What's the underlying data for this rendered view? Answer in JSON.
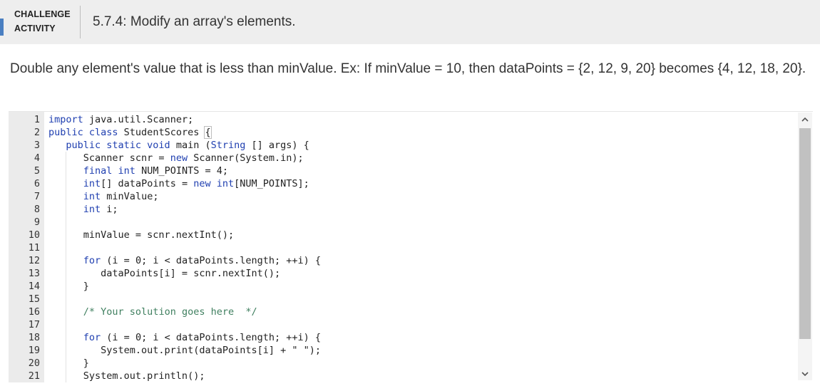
{
  "header": {
    "badge_line1": "CHALLENGE",
    "badge_line2": "ACTIVITY",
    "title": "5.7.4: Modify an array's elements."
  },
  "description": "Double any element's value that is less than minValue. Ex: If minValue = 10, then dataPoints = {2, 12, 9, 20} becomes {4, 12, 18, 20}.",
  "editor": {
    "lines": [
      {
        "n": "1",
        "parts": [
          {
            "t": "import",
            "c": "kw"
          },
          {
            "t": " java.util.Scanner;"
          }
        ]
      },
      {
        "n": "2",
        "parts": [
          {
            "t": "public class",
            "c": "kw"
          },
          {
            "t": " StudentScores "
          },
          {
            "t": "{",
            "c": "brace"
          }
        ]
      },
      {
        "n": "3",
        "parts": [
          {
            "t": "   "
          },
          {
            "t": "public static void",
            "c": "kw"
          },
          {
            "t": " main ("
          },
          {
            "t": "String",
            "c": "kw"
          },
          {
            "t": " [] args) {"
          }
        ]
      },
      {
        "n": "4",
        "parts": [
          {
            "t": "      Scanner scnr = "
          },
          {
            "t": "new",
            "c": "kw"
          },
          {
            "t": " Scanner(System.in);"
          }
        ]
      },
      {
        "n": "5",
        "parts": [
          {
            "t": "      "
          },
          {
            "t": "final int",
            "c": "kw"
          },
          {
            "t": " NUM_POINTS = 4;"
          }
        ]
      },
      {
        "n": "6",
        "parts": [
          {
            "t": "      "
          },
          {
            "t": "int",
            "c": "kw"
          },
          {
            "t": "[] dataPoints = "
          },
          {
            "t": "new int",
            "c": "kw"
          },
          {
            "t": "[NUM_POINTS];"
          }
        ]
      },
      {
        "n": "7",
        "parts": [
          {
            "t": "      "
          },
          {
            "t": "int",
            "c": "kw"
          },
          {
            "t": " minValue;"
          }
        ]
      },
      {
        "n": "8",
        "parts": [
          {
            "t": "      "
          },
          {
            "t": "int",
            "c": "kw"
          },
          {
            "t": " i;"
          }
        ]
      },
      {
        "n": "9",
        "parts": []
      },
      {
        "n": "10",
        "parts": [
          {
            "t": "      minValue = scnr.nextInt();"
          }
        ]
      },
      {
        "n": "11",
        "parts": []
      },
      {
        "n": "12",
        "parts": [
          {
            "t": "      "
          },
          {
            "t": "for",
            "c": "kw"
          },
          {
            "t": " (i = 0; i < dataPoints.length; ++i) {"
          }
        ]
      },
      {
        "n": "13",
        "parts": [
          {
            "t": "         dataPoints[i] = scnr.nextInt();"
          }
        ]
      },
      {
        "n": "14",
        "parts": [
          {
            "t": "      }"
          }
        ]
      },
      {
        "n": "15",
        "parts": []
      },
      {
        "n": "16",
        "parts": [
          {
            "t": "      "
          },
          {
            "t": "/* Your solution goes here  */",
            "c": "cm"
          }
        ]
      },
      {
        "n": "17",
        "parts": []
      },
      {
        "n": "18",
        "parts": [
          {
            "t": "      "
          },
          {
            "t": "for",
            "c": "kw"
          },
          {
            "t": " (i = 0; i < dataPoints.length; ++i) {"
          }
        ]
      },
      {
        "n": "19",
        "parts": [
          {
            "t": "         System.out.print(dataPoints[i] + \" \");"
          }
        ]
      },
      {
        "n": "20",
        "parts": [
          {
            "t": "      }"
          }
        ]
      },
      {
        "n": "21",
        "parts": [
          {
            "t": "      System.out.println();"
          }
        ]
      }
    ]
  },
  "colors": {
    "keyword": "#1f3fb0",
    "comment": "#3f7f5f",
    "accent": "#4a7fc1",
    "header_bg": "#eeeeee"
  },
  "icons": {
    "scroll_up": "chevron-up-icon",
    "scroll_down": "chevron-down-icon"
  }
}
